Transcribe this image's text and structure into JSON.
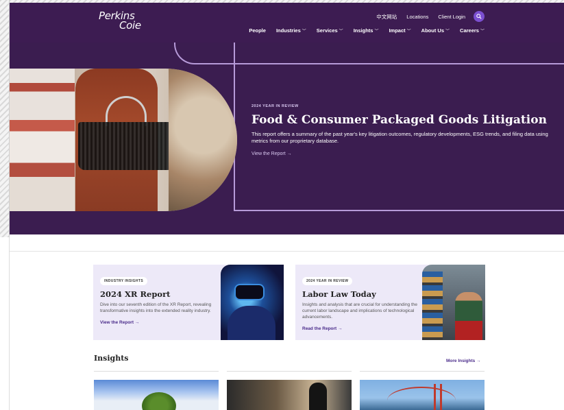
{
  "header": {
    "logo_line1": "Perkins",
    "logo_line2": "Coie",
    "utility": [
      "中文网站",
      "Locations",
      "Client Login"
    ],
    "nav": [
      {
        "label": "People",
        "caret": false
      },
      {
        "label": "Industries",
        "caret": true
      },
      {
        "label": "Services",
        "caret": true
      },
      {
        "label": "Insights",
        "caret": true
      },
      {
        "label": "Impact",
        "caret": true
      },
      {
        "label": "About Us",
        "caret": true
      },
      {
        "label": "Careers",
        "caret": true
      }
    ]
  },
  "hero": {
    "eyebrow": "2024 YEAR IN REVIEW",
    "title": "Food & Consumer Packaged Goods Litigation",
    "description": "This report offers a summary of the past year's key litigation outcomes, regulatory developments, ESG trends, and filing data using metrics from our proprietary database.",
    "link": "View the Report →"
  },
  "cards": [
    {
      "tag": "INDUSTRY INSIGHTS",
      "title": "2024 XR Report",
      "description": "Dive into our seventh edition of the XR Report, revealing transformative insights into the extended reality industry.",
      "link": "View the Report →"
    },
    {
      "tag": "2024 YEAR IN REVIEW",
      "title": "Labor Law Today",
      "description": "Insights and analysis that are crucial for understanding the current labor landscape and implications of technological advancements.",
      "link": "Read the Report →"
    }
  ],
  "insights": {
    "heading": "Insights",
    "more_link": "More Insights →"
  },
  "colors": {
    "brand_dark": "#3b1d50",
    "accent": "#7b4fd0",
    "card_bg": "#ede9f8",
    "link": "#4a2b8a"
  }
}
